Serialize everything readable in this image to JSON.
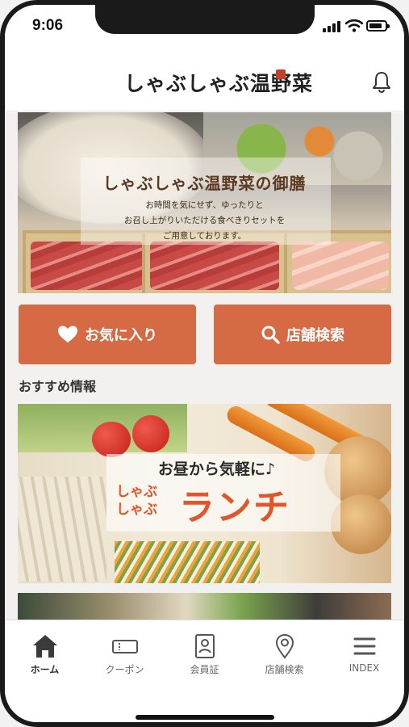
{
  "status": {
    "time": "9:06"
  },
  "header": {
    "logo": "しゃぶしゃぶ温野菜",
    "bell_icon": "bell-icon"
  },
  "hero": {
    "title": "しゃぶしゃぶ温野菜の御膳",
    "subtitle": "お時間を気にせず、ゆったりと\nお召し上がりいただける食べきりセットを\nご用意しております。"
  },
  "actions": {
    "favorite": {
      "label": "お気に入り",
      "icon": "heart-icon"
    },
    "store_search": {
      "label": "店舗検索",
      "icon": "search-icon"
    }
  },
  "recommend": {
    "title": "おすすめ情報",
    "banner": {
      "top": "お昼から気軽に♪",
      "small": "しゃぶ\nしゃぶ",
      "big": "ランチ"
    }
  },
  "tabs": [
    {
      "label": "ホーム",
      "icon": "home-icon",
      "active": true
    },
    {
      "label": "クーポン",
      "icon": "coupon-icon",
      "active": false
    },
    {
      "label": "会員証",
      "icon": "member-card-icon",
      "active": false
    },
    {
      "label": "店舗検索",
      "icon": "location-pin-icon",
      "active": false
    },
    {
      "label": "INDEX",
      "icon": "menu-icon",
      "active": false
    }
  ],
  "colors": {
    "accent": "#d66a44",
    "banner_text": "#e0562b"
  }
}
